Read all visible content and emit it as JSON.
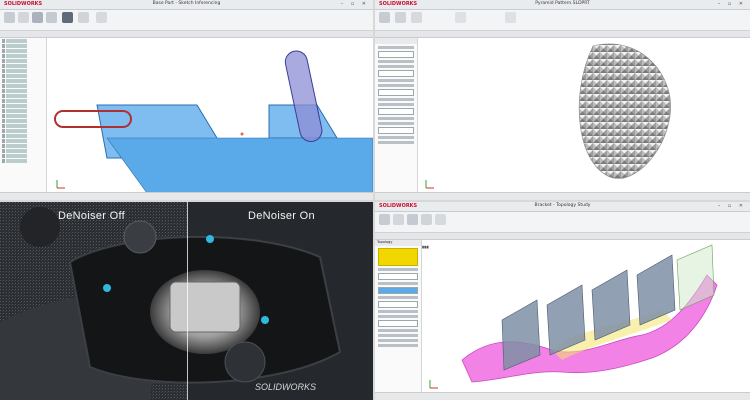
{
  "windows": {
    "sketch": {
      "app_logo": "SOLIDWORKS",
      "title": "Base Part - Sketch Inferencing"
    },
    "texture": {
      "app_logo": "SOLIDWORKS",
      "title": "Pyramid Pattern.SLDPRT"
    },
    "render": {
      "caption_left": "DeNoiser Off",
      "caption_right": "DeNoiser On",
      "watermark": "SOLIDWORKS"
    },
    "topology": {
      "app_logo": "SOLIDWORKS",
      "title": "Bracket - Topology Study",
      "pm_header": "Topology"
    }
  },
  "colors": {
    "brand_red": "#c8102e",
    "model_blue": "#5aa9e8",
    "topo_pink": "#f06ce0",
    "plane_gray": "#7f8fa6",
    "sketch_slot_red": "#b03030",
    "accent_yellow": "#f2d600"
  },
  "icons": [
    "minimize-icon",
    "maximize-icon",
    "close-icon",
    "axis-triad-icon"
  ]
}
